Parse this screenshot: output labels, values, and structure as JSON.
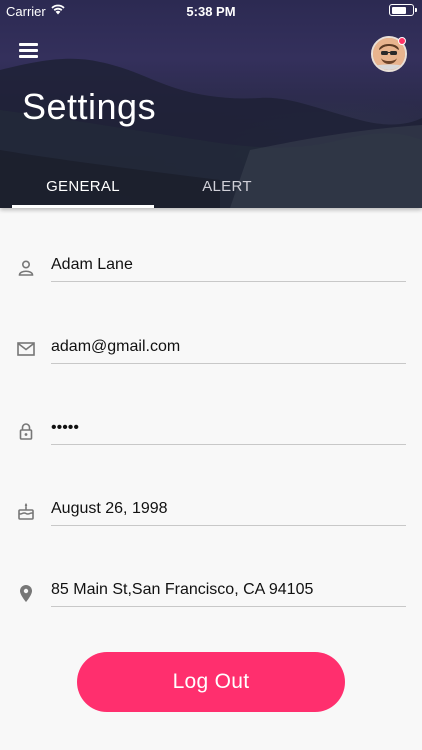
{
  "status_bar": {
    "carrier": "Carrier",
    "time": "5:38 PM",
    "battery_level": 0.75
  },
  "header": {
    "title": "Settings"
  },
  "tabs": [
    {
      "label": "GENERAL",
      "active": true
    },
    {
      "label": "ALERT",
      "active": false
    }
  ],
  "fields": {
    "name": {
      "value": "Adam Lane",
      "icon": "person-icon"
    },
    "email": {
      "value": "adam@gmail.com",
      "icon": "mail-icon"
    },
    "password": {
      "value": "•••••",
      "icon": "lock-icon"
    },
    "birthday": {
      "value": "August 26, 1998",
      "icon": "cake-icon"
    },
    "address": {
      "value": "85 Main St,San Francisco, CA 94105",
      "icon": "location-pin-icon"
    }
  },
  "actions": {
    "logout_label": "Log Out"
  },
  "colors": {
    "accent": "#ff2f6e",
    "header_bg": "#2c2a52",
    "tab_indicator": "#ffffff",
    "notification": "#ff3366"
  }
}
